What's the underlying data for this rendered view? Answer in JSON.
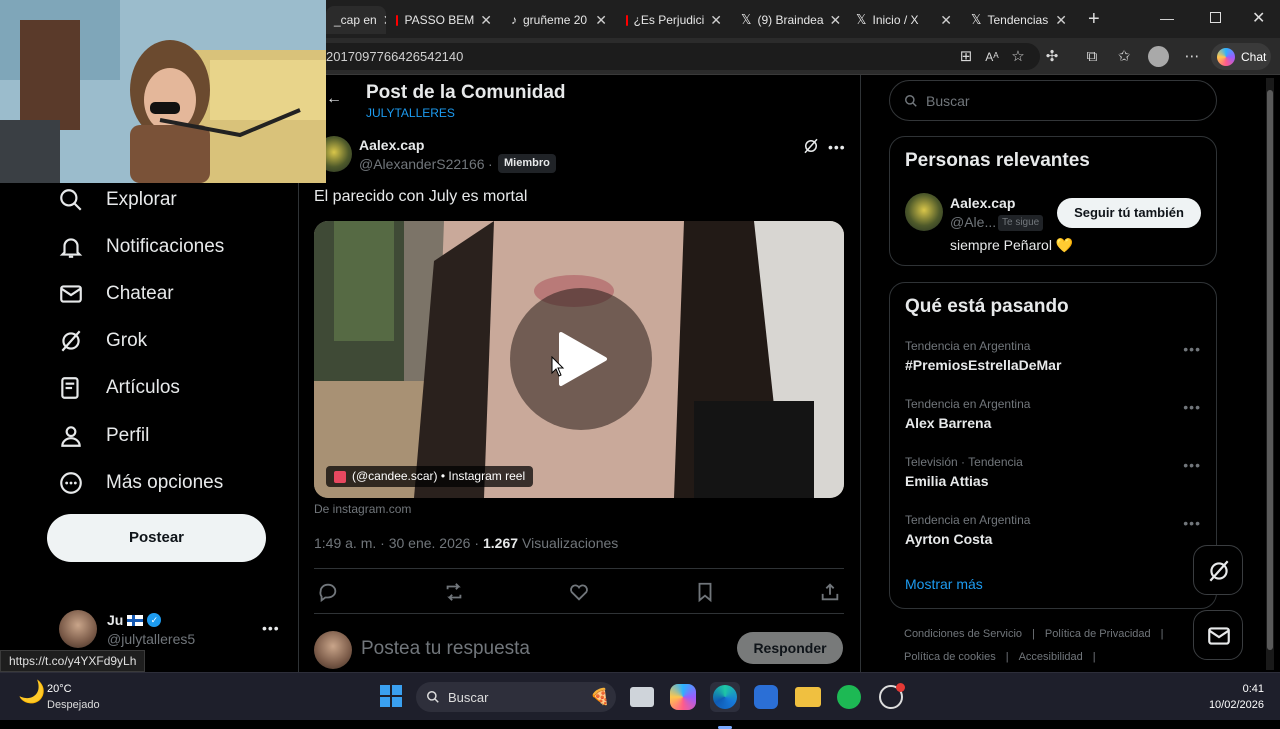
{
  "browser": {
    "tabs": [
      {
        "label": "_cap en",
        "icon": "x-icon",
        "active": true
      },
      {
        "label": "PASSO BEM",
        "icon": "youtube-icon"
      },
      {
        "label": "gruñeme 20",
        "icon": "tiktok-icon"
      },
      {
        "label": "¿Es Perjudici",
        "icon": "youtube-icon"
      },
      {
        "label": "(9) Braindea",
        "icon": "x-icon"
      },
      {
        "label": "Inicio / X",
        "icon": "x-icon"
      },
      {
        "label": "Tendencias",
        "icon": "x-icon"
      }
    ],
    "url": "2017097766426542140",
    "chat_label": "Chat"
  },
  "nav": {
    "items": [
      {
        "label": "Explorar",
        "icon": "search-icon"
      },
      {
        "label": "Notificaciones",
        "icon": "bell-icon"
      },
      {
        "label": "Chatear",
        "icon": "mail-icon"
      },
      {
        "label": "Grok",
        "icon": "grok-icon"
      },
      {
        "label": "Artículos",
        "icon": "article-icon"
      },
      {
        "label": "Perfil",
        "icon": "user-icon"
      },
      {
        "label": "Más opciones",
        "icon": "more-circle-icon"
      }
    ],
    "post_button": "Postear",
    "account": {
      "name": "Ju",
      "handle": "@julytalleres5"
    },
    "status_url": "https://t.co/y4YXFd9yLh"
  },
  "post": {
    "title": "Post de la Comunidad",
    "community": "JULYTALLERES",
    "author_name": "Aalex.cap",
    "author_handle": "@AlexanderS22166",
    "separator": "·",
    "role_badge": "Miembro",
    "text": "El parecido con July es mortal",
    "media_tag": "(@candee.scar) • Instagram reel",
    "source": "De instagram.com",
    "time": "1:49 a. m. · 30 ene. 2026 ·",
    "views_count": "1.267",
    "views_label": "Visualizaciones",
    "reply_placeholder": "Postea tu respuesta",
    "reply_button": "Responder"
  },
  "sidebar": {
    "search_placeholder": "Buscar",
    "relevant": {
      "title": "Personas relevantes",
      "name": "Aalex.cap",
      "handle": "@Ale...",
      "follows_you": "Te sigue",
      "bio": "siempre Peñarol 💛",
      "follow_button": "Seguir tú también"
    },
    "trends": {
      "title": "Qué está pasando",
      "items": [
        {
          "category": "Tendencia en Argentina",
          "name": "#PremiosEstrellaDeMar"
        },
        {
          "category": "Tendencia en Argentina",
          "name": "Alex Barrena"
        },
        {
          "category": "Televisión · Tendencia",
          "name": "Emilia Attias"
        },
        {
          "category": "Tendencia en Argentina",
          "name": "Ayrton Costa"
        }
      ],
      "show_more": "Mostrar más"
    },
    "footer": [
      "Condiciones de Servicio",
      "Política de Privacidad",
      "Política de cookies",
      "Accesibilidad"
    ]
  },
  "taskbar": {
    "weather_temp": "20°C",
    "weather_desc": "Despejado",
    "search_label": "Buscar",
    "time": "0:41",
    "date": "10/02/2026"
  },
  "colors": {
    "accent": "#1d9bf0",
    "background": "#000000",
    "text": "#e7e9ea",
    "muted": "#71767b"
  }
}
